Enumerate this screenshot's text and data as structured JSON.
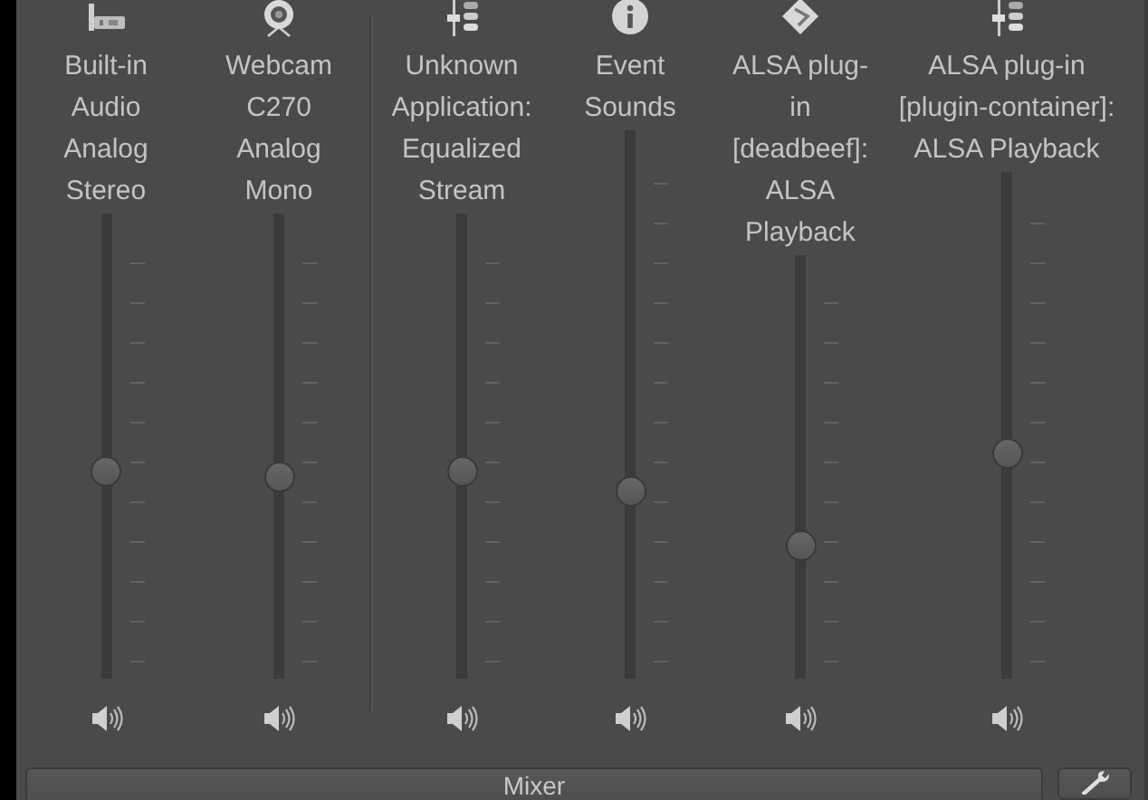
{
  "streams": [
    {
      "kind": "sound-card",
      "label_lines": [
        "Built-in",
        "Audio",
        "Analog",
        "Stereo"
      ],
      "level": 0.44
    },
    {
      "kind": "webcam",
      "label_lines": [
        "Webcam",
        "C270",
        "Analog",
        "Mono"
      ],
      "level": 0.43
    },
    {
      "kind": "application",
      "label_lines": [
        "Unknown",
        "Application:",
        "Equalized",
        "Stream"
      ],
      "level": 0.44
    },
    {
      "kind": "event",
      "label_lines": [
        "Event",
        "Sounds"
      ],
      "level": 0.33
    },
    {
      "kind": "player",
      "label_lines": [
        "ALSA plug-",
        "in",
        "[deadbeef]:",
        "ALSA",
        "Playback"
      ],
      "level": 0.3
    },
    {
      "kind": "application",
      "label_lines": [
        "ALSA plug-in",
        "[plugin-container]:",
        "ALSA Playback"
      ],
      "level": 0.44
    }
  ],
  "bottom_bar": {
    "mixer_button": {
      "label": "Mixer"
    }
  }
}
